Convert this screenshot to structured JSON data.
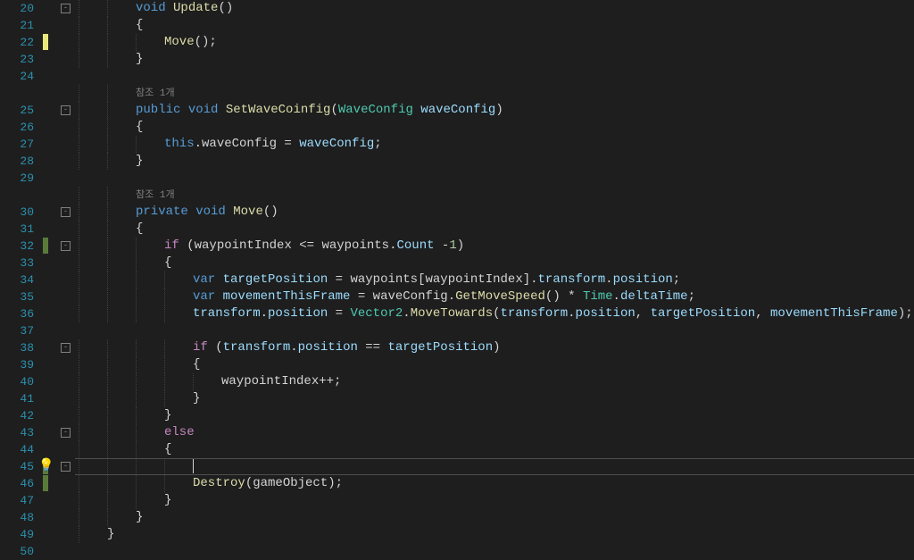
{
  "lineNumbers": [
    "20",
    "21",
    "22",
    "23",
    "24",
    "",
    "25",
    "26",
    "27",
    "28",
    "29",
    "",
    "30",
    "31",
    "32",
    "33",
    "34",
    "35",
    "36",
    "37",
    "38",
    "39",
    "40",
    "41",
    "42",
    "43",
    "44",
    "45",
    "46",
    "47",
    "48",
    "49",
    "50"
  ],
  "codelens": {
    "ref1": "참조 1개",
    "ref2": "참조 1개"
  },
  "lines": {
    "l20": {
      "indent": "        ",
      "tokens": [
        [
          "kw",
          "void"
        ],
        [
          "punct",
          " "
        ],
        [
          "method",
          "Update"
        ],
        [
          "punct",
          "()"
        ]
      ]
    },
    "l21": {
      "indent": "        ",
      "tokens": [
        [
          "punct",
          "{"
        ]
      ]
    },
    "l22": {
      "indent": "            ",
      "tokens": [
        [
          "method",
          "Move"
        ],
        [
          "punct",
          "();"
        ]
      ]
    },
    "l23": {
      "indent": "        ",
      "tokens": [
        [
          "punct",
          "}"
        ]
      ]
    },
    "l24": {
      "indent": "",
      "tokens": []
    },
    "lref1": {
      "indent": "        ",
      "tokens": []
    },
    "l25": {
      "indent": "        ",
      "tokens": [
        [
          "kw",
          "public"
        ],
        [
          "punct",
          " "
        ],
        [
          "kw",
          "void"
        ],
        [
          "punct",
          " "
        ],
        [
          "method",
          "SetWaveCoinfig"
        ],
        [
          "punct",
          "("
        ],
        [
          "type",
          "WaveConfig"
        ],
        [
          "punct",
          " "
        ],
        [
          "local",
          "waveConfig"
        ],
        [
          "punct",
          ")"
        ]
      ]
    },
    "l26": {
      "indent": "        ",
      "tokens": [
        [
          "punct",
          "{"
        ]
      ]
    },
    "l27": {
      "indent": "            ",
      "tokens": [
        [
          "kw",
          "this"
        ],
        [
          "punct",
          "."
        ],
        [
          "field",
          "waveConfig"
        ],
        [
          "punct",
          " = "
        ],
        [
          "local",
          "waveConfig"
        ],
        [
          "punct",
          ";"
        ]
      ]
    },
    "l28": {
      "indent": "        ",
      "tokens": [
        [
          "punct",
          "}"
        ]
      ]
    },
    "l29": {
      "indent": "",
      "tokens": []
    },
    "lref2": {
      "indent": "        ",
      "tokens": []
    },
    "l30": {
      "indent": "        ",
      "tokens": [
        [
          "kw",
          "private"
        ],
        [
          "punct",
          " "
        ],
        [
          "kw",
          "void"
        ],
        [
          "punct",
          " "
        ],
        [
          "method",
          "Move"
        ],
        [
          "punct",
          "()"
        ]
      ]
    },
    "l31": {
      "indent": "        ",
      "tokens": [
        [
          "punct",
          "{"
        ]
      ]
    },
    "l32": {
      "indent": "            ",
      "tokens": [
        [
          "kw2",
          "if"
        ],
        [
          "punct",
          " ("
        ],
        [
          "field",
          "waypointIndex"
        ],
        [
          "punct",
          " <= "
        ],
        [
          "field",
          "waypoints"
        ],
        [
          "punct",
          "."
        ],
        [
          "prop",
          "Count"
        ],
        [
          "punct",
          " -"
        ],
        [
          "num",
          "1"
        ],
        [
          "punct",
          ")"
        ]
      ]
    },
    "l33": {
      "indent": "            ",
      "tokens": [
        [
          "punct",
          "{"
        ]
      ]
    },
    "l34": {
      "indent": "                ",
      "tokens": [
        [
          "kw",
          "var"
        ],
        [
          "punct",
          " "
        ],
        [
          "local",
          "targetPosition"
        ],
        [
          "punct",
          " = "
        ],
        [
          "field",
          "waypoints"
        ],
        [
          "punct",
          "["
        ],
        [
          "field",
          "waypointIndex"
        ],
        [
          "punct",
          "]."
        ],
        [
          "prop",
          "transform"
        ],
        [
          "punct",
          "."
        ],
        [
          "prop",
          "position"
        ],
        [
          "punct",
          ";"
        ]
      ]
    },
    "l35": {
      "indent": "                ",
      "tokens": [
        [
          "kw",
          "var"
        ],
        [
          "punct",
          " "
        ],
        [
          "local",
          "movementThisFrame"
        ],
        [
          "punct",
          " = "
        ],
        [
          "field",
          "waveConfig"
        ],
        [
          "punct",
          "."
        ],
        [
          "method",
          "GetMoveSpeed"
        ],
        [
          "punct",
          "() * "
        ],
        [
          "type",
          "Time"
        ],
        [
          "punct",
          "."
        ],
        [
          "prop",
          "deltaTime"
        ],
        [
          "punct",
          ";"
        ]
      ]
    },
    "l36": {
      "indent": "                ",
      "tokens": [
        [
          "prop",
          "transform"
        ],
        [
          "punct",
          "."
        ],
        [
          "prop",
          "position"
        ],
        [
          "punct",
          " = "
        ],
        [
          "type",
          "Vector2"
        ],
        [
          "punct",
          "."
        ],
        [
          "method",
          "MoveTowards"
        ],
        [
          "punct",
          "("
        ],
        [
          "prop",
          "transform"
        ],
        [
          "punct",
          "."
        ],
        [
          "prop",
          "position"
        ],
        [
          "punct",
          ", "
        ],
        [
          "local",
          "targetPosition"
        ],
        [
          "punct",
          ", "
        ],
        [
          "local",
          "movementThisFrame"
        ],
        [
          "punct",
          ");"
        ]
      ]
    },
    "l37": {
      "indent": "",
      "tokens": []
    },
    "l38": {
      "indent": "                ",
      "tokens": [
        [
          "kw2",
          "if"
        ],
        [
          "punct",
          " ("
        ],
        [
          "prop",
          "transform"
        ],
        [
          "punct",
          "."
        ],
        [
          "prop",
          "position"
        ],
        [
          "punct",
          " == "
        ],
        [
          "local",
          "targetPosition"
        ],
        [
          "punct",
          ")"
        ]
      ]
    },
    "l39": {
      "indent": "                ",
      "tokens": [
        [
          "punct",
          "{"
        ]
      ]
    },
    "l40": {
      "indent": "                    ",
      "tokens": [
        [
          "field",
          "waypointIndex"
        ],
        [
          "punct",
          "++;"
        ]
      ]
    },
    "l41": {
      "indent": "                ",
      "tokens": [
        [
          "punct",
          "}"
        ]
      ]
    },
    "l42": {
      "indent": "            ",
      "tokens": [
        [
          "punct",
          "}"
        ]
      ]
    },
    "l43": {
      "indent": "            ",
      "tokens": [
        [
          "kw2",
          "else"
        ]
      ]
    },
    "l44": {
      "indent": "            ",
      "tokens": [
        [
          "punct",
          "{"
        ]
      ]
    },
    "l45": {
      "indent": "                ",
      "tokens": []
    },
    "l46": {
      "indent": "                ",
      "tokens": [
        [
          "method",
          "Destroy"
        ],
        [
          "punct",
          "("
        ],
        [
          "field",
          "gameObject"
        ],
        [
          "punct",
          ");"
        ]
      ]
    },
    "l47": {
      "indent": "            ",
      "tokens": [
        [
          "punct",
          "}"
        ]
      ]
    },
    "l48": {
      "indent": "        ",
      "tokens": [
        [
          "punct",
          "}"
        ]
      ]
    },
    "l49": {
      "indent": "    ",
      "tokens": [
        [
          "punct",
          "}"
        ]
      ]
    },
    "l50": {
      "indent": "",
      "tokens": []
    }
  },
  "lineOrder": [
    "l20",
    "l21",
    "l22",
    "l23",
    "l24",
    "lref1",
    "l25",
    "l26",
    "l27",
    "l28",
    "l29",
    "lref2",
    "l30",
    "l31",
    "l32",
    "l33",
    "l34",
    "l35",
    "l36",
    "l37",
    "l38",
    "l39",
    "l40",
    "l41",
    "l42",
    "l43",
    "l44",
    "l45",
    "l46",
    "l47",
    "l48",
    "l49",
    "l50"
  ],
  "markers": {
    "yellow": [
      2
    ],
    "green": [
      14,
      27,
      28
    ],
    "bulb": [
      27
    ]
  },
  "foldMarks": [
    0,
    6,
    12,
    14,
    20,
    25,
    27
  ],
  "currentLine": 27,
  "icons": {
    "bulb": "💡"
  }
}
